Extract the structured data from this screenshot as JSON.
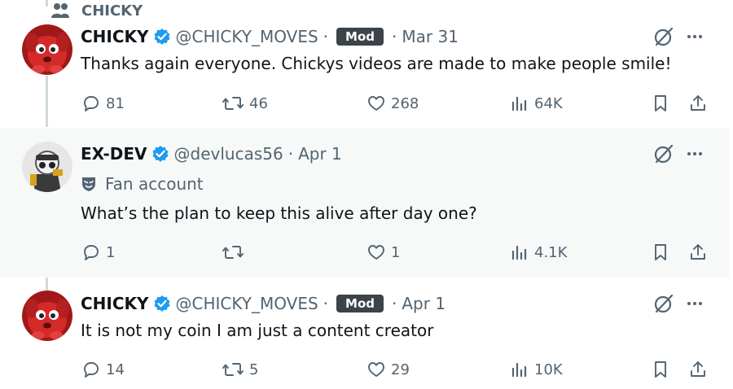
{
  "community": {
    "name": "CHICKY",
    "icon": "community-icon"
  },
  "colors": {
    "verified": "#1d9bf0",
    "muted": "#536471",
    "mod_badge": "#3c4349",
    "highlight_bg": "#f7f9f9"
  },
  "posts": [
    {
      "display_name": "CHICKY",
      "handle": "@CHICKY_MOVES",
      "badge": "Mod",
      "separator": "·",
      "date": "Mar 31",
      "text": "Thanks again everyone. Chickys videos are made to make people smile!",
      "replies": "81",
      "reposts": "46",
      "likes": "268",
      "views": "64K"
    },
    {
      "display_name": "EX-DEV",
      "handle": "@devlucas56",
      "separator": "·",
      "date": "Apr 1",
      "label": "Fan account",
      "text": "What’s the plan to keep this alive after day one?",
      "replies": "1",
      "reposts": "",
      "likes": "1",
      "views": "4.1K"
    },
    {
      "display_name": "CHICKY",
      "handle": "@CHICKY_MOVES",
      "badge": "Mod",
      "separator": "·",
      "date": "Apr 1",
      "text": "It is not my coin I am just a content creator",
      "replies": "14",
      "reposts": "5",
      "likes": "29",
      "views": "10K"
    }
  ]
}
